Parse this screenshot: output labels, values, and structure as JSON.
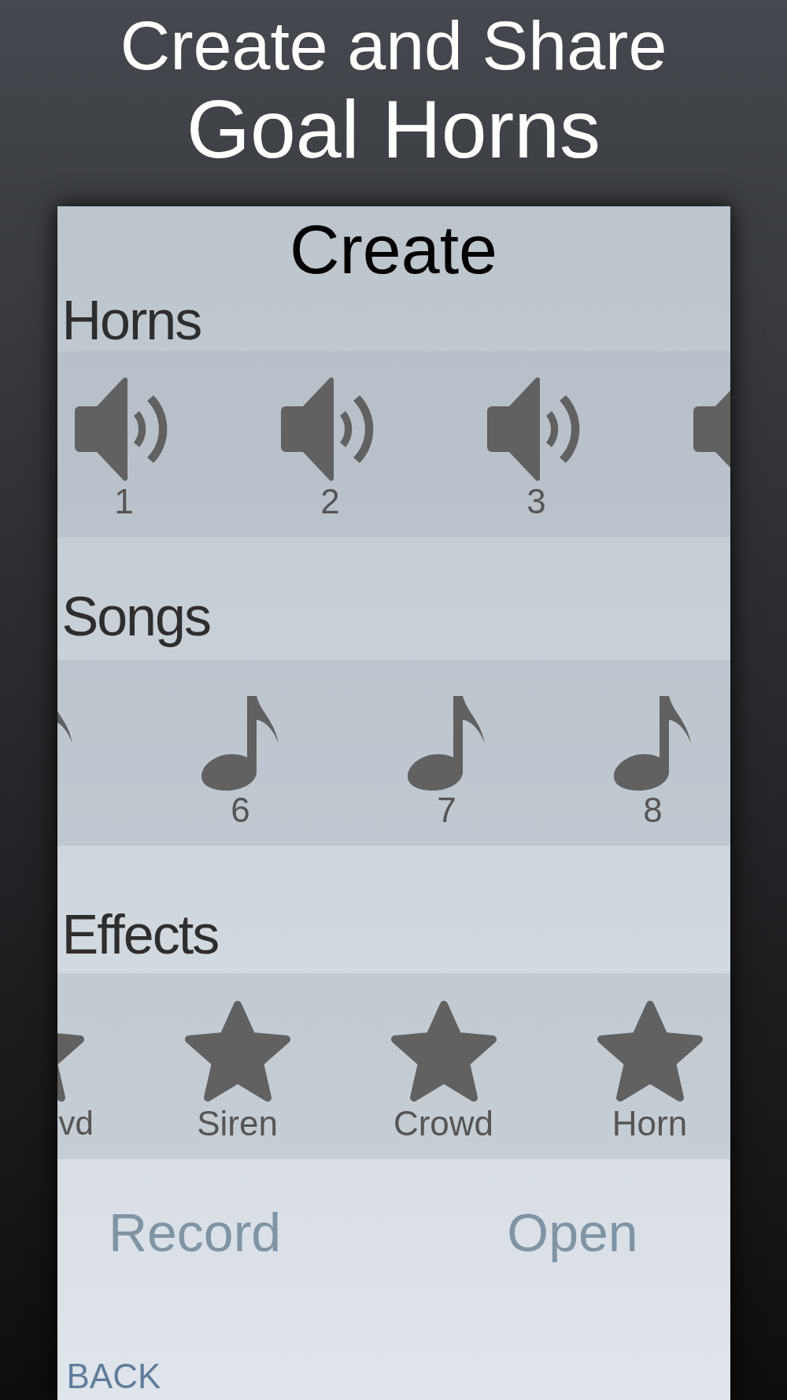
{
  "headline": {
    "line_1": "Create and Share",
    "line_2": "Goal Horns"
  },
  "screen": {
    "title": "Create",
    "sections": [
      {
        "heading": "Horns",
        "items": [
          {
            "kind": "full",
            "label": "1"
          },
          {
            "kind": "full",
            "label": "2"
          },
          {
            "kind": "full",
            "label": "3"
          },
          {
            "kind": "cut"
          }
        ]
      },
      {
        "heading": "Songs",
        "items": [
          {
            "kind": "cut"
          },
          {
            "kind": "full",
            "label": "6"
          },
          {
            "kind": "full",
            "label": "7"
          },
          {
            "kind": "full",
            "label": "8"
          }
        ]
      },
      {
        "heading": "Effects",
        "items": [
          {
            "kind": "cut",
            "label": "vd"
          },
          {
            "kind": "full",
            "label": "Siren"
          },
          {
            "kind": "full",
            "label": "Crowd"
          },
          {
            "kind": "full",
            "label": "Horn"
          }
        ]
      }
    ],
    "actions": [
      "Record",
      "Open"
    ],
    "back": "BACK"
  }
}
